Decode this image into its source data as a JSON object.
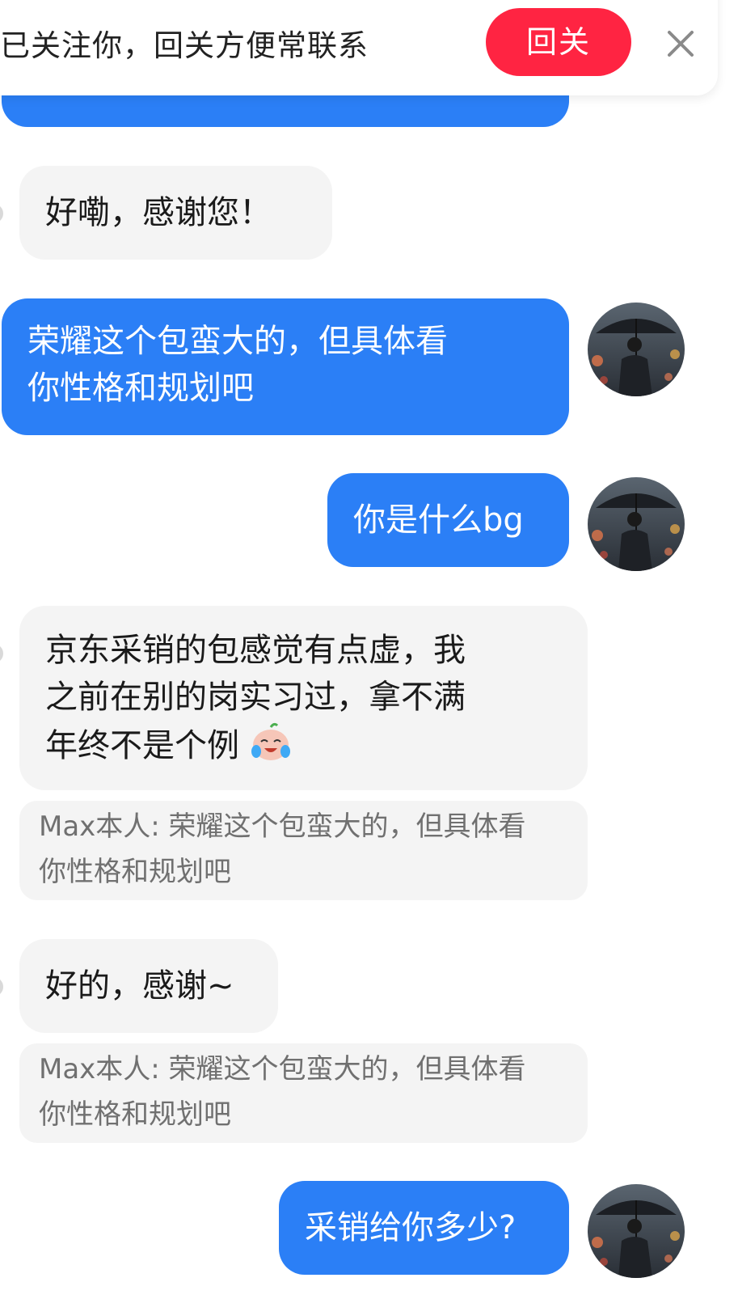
{
  "banner": {
    "text": "已关注你，回关方便常联系",
    "follow_button": "回关",
    "close_icon": "close-icon",
    "accent_color": "#ff2442"
  },
  "messages": [
    {
      "from": "me",
      "text": ""
    },
    {
      "from": "other",
      "text": "好嘞，感谢您！"
    },
    {
      "from": "me",
      "lines": [
        "荣耀这个包蛮大的，但具体看",
        "你性格和规划吧"
      ]
    },
    {
      "from": "me",
      "text": "你是什么bg"
    },
    {
      "from": "other",
      "lines": [
        "京东采销的包感觉有点虚，我",
        "之前在别的岗实习过，拿不满",
        "年终不是个例"
      ],
      "emoji": "crying-laughing-emoji",
      "quote": {
        "lines": [
          "Max本人: 荣耀这个包蛮大的，但具体看",
          "你性格和规划吧"
        ]
      }
    },
    {
      "from": "other",
      "text": "好的，感谢~",
      "quote": {
        "lines": [
          "Max本人: 荣耀这个包蛮大的，但具体看",
          "你性格和规划吧"
        ]
      }
    },
    {
      "from": "me",
      "text": "采销给你多少?"
    }
  ],
  "colors": {
    "sent_bubble": "#2b7ff6",
    "received_bubble": "#f4f4f4"
  }
}
